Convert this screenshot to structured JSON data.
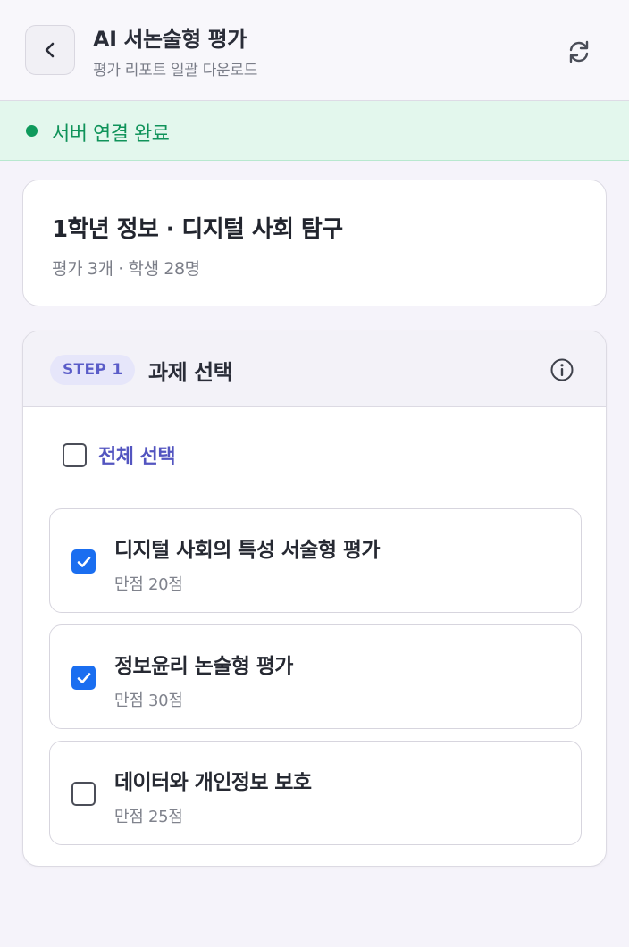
{
  "header": {
    "title": "AI 서논술형 평가",
    "subtitle": "평가 리포트 일괄 다운로드",
    "back_icon": "chevron-left-icon",
    "refresh_icon": "refresh-icon"
  },
  "status": {
    "text": "서버 연결 완료",
    "color": "#10935a"
  },
  "class_info": {
    "title": "1학년 정보 · 디지털 사회 탐구",
    "meta": "평가 3개 · 학생 28명"
  },
  "step": {
    "badge": "STEP 1",
    "title": "과제 선택",
    "info_icon": "info-icon",
    "select_all_label": "전체 선택",
    "select_all_checked": false,
    "tasks": [
      {
        "title": "디지털 사회의 특성 서술형 평가",
        "score": "만점 20점",
        "checked": true
      },
      {
        "title": "정보윤리 논술형 평가",
        "score": "만점 30점",
        "checked": true
      },
      {
        "title": "데이터와 개인정보 보호",
        "score": "만점 25점",
        "checked": false
      }
    ]
  },
  "colors": {
    "accent": "#5355c0",
    "checkbox": "#1a6ef0",
    "status_bg": "#e3f7ed"
  }
}
